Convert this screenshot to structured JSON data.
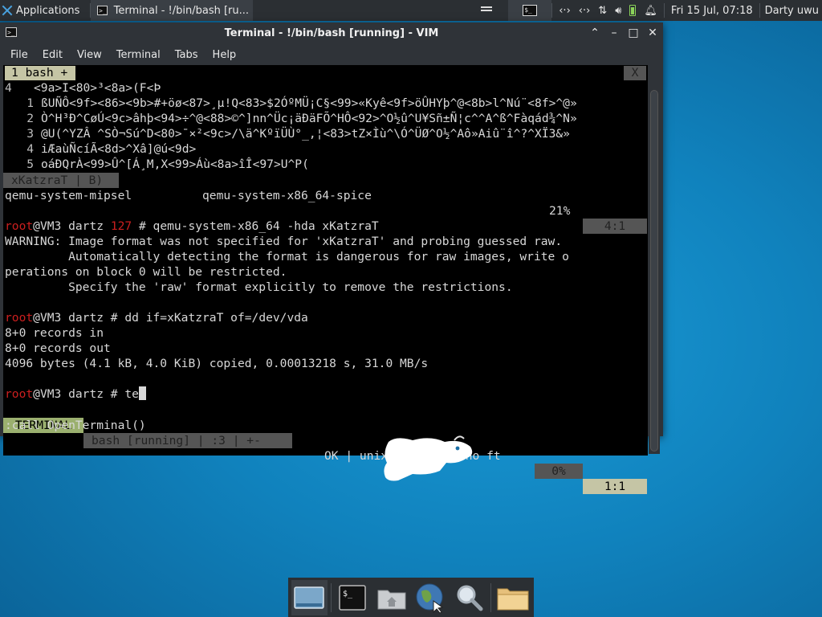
{
  "panel": {
    "apps_label": "Applications",
    "task_label": "Terminal - !/bin/bash [ru...",
    "clock": "Fri 15 Jul, 07:18",
    "user": "Darty uwu",
    "ws2_text": "$_"
  },
  "window": {
    "title": "Terminal - !/bin/bash [running] - VIM",
    "menu": [
      "File",
      "Edit",
      "View",
      "Terminal",
      "Tabs",
      "Help"
    ]
  },
  "vim": {
    "tab_label": "1 bash +",
    "tab_close": "X",
    "lines": [
      {
        "n": "4",
        "text": "<9a>I<80>³<8a>(F<Þ"
      },
      {
        "n": "1",
        "text": "ßUÑÔ<9f><86><9b>#+öø<87>¸µ!Q<83>$2ÓºMÜ¡C§<99>«Kyê<9f>öÛHYþ^@<8b>l^Nú¨<8f>^@»"
      },
      {
        "n": "2",
        "text": "Ò^H³Ð^CøÚ<9c>âhþ<94>÷^@<88>©^]nn^Üc¡äÐäFÕ^HÔ<92>^O½û^U¥Sñ±Ñ¦c^^A^ß^Fàqád¾^N»"
      },
      {
        "n": "3",
        "text": "@U(^YZÂ ^SÒ¬Sú^D<80>¯×²<9c>/\\ä^KºïÜÙ°_,¦<83>tZ×Ìù^\\Ó^ÜØ^O½^Aô»Aiû¨î^?^XÏ3&»"
      },
      {
        "n": "4",
        "text": "iÆaùÑcíÃ<8d>^Xâ]@ú<9d>"
      },
      {
        "n": "5",
        "text": "oáÐQrÀ<99>Û^[Á¸M,X<99>Áù<8a>îÎ<97>U^P("
      }
    ],
    "status1_name": "xKatzraT | B)",
    "status1_pct": "21%",
    "status1_pos": "4:1",
    "term_lines": [
      {
        "segs": [
          {
            "t": "qemu-system-mipsel          qemu-system-x86_64-spice"
          }
        ]
      },
      {
        "segs": [
          {
            "t": ""
          }
        ]
      },
      {
        "segs": [
          {
            "t": "root",
            "c": "red"
          },
          {
            "t": "@VM3 dartz "
          },
          {
            "t": "127",
            "c": "red"
          },
          {
            "t": " # qemu-system-x86_64 -hda xKatzraT"
          }
        ]
      },
      {
        "segs": [
          {
            "t": "WARNING: Image format was not specified for 'xKatzraT' and probing guessed raw."
          }
        ]
      },
      {
        "segs": [
          {
            "t": "         Automatically detecting the format is dangerous for raw images, write o"
          }
        ]
      },
      {
        "segs": [
          {
            "t": "perations on block 0 will be restricted."
          }
        ]
      },
      {
        "segs": [
          {
            "t": "         Specify the 'raw' format explicitly to remove the restrictions."
          }
        ]
      },
      {
        "segs": [
          {
            "t": ""
          }
        ]
      },
      {
        "segs": [
          {
            "t": "root",
            "c": "red"
          },
          {
            "t": "@VM3 dartz # dd if=xKatzraT of=/dev/vda"
          }
        ]
      },
      {
        "segs": [
          {
            "t": "8+0 records in"
          }
        ]
      },
      {
        "segs": [
          {
            "t": "8+0 records out"
          }
        ]
      },
      {
        "segs": [
          {
            "t": "4096 bytes (4.1 kB, 4.0 KiB) copied, 0.00013218 s, 31.0 MB/s"
          }
        ]
      },
      {
        "segs": [
          {
            "t": ""
          }
        ]
      }
    ],
    "prompt_user": "root",
    "prompt_rest": "@VM3 dartz # te",
    "status2_mode": "TERMINAL",
    "status2_buf": "bash [running] | :3 | +-",
    "status2_info": "OK | unix | utf-8 | no ft",
    "status2_pct": "0%",
    "status2_pos": "1:1",
    "cmdline": ":call OpenTerminal()"
  },
  "dock": {
    "items": [
      "show-desktop",
      "terminal",
      "home-folder",
      "web-browser",
      "search",
      "files"
    ]
  }
}
